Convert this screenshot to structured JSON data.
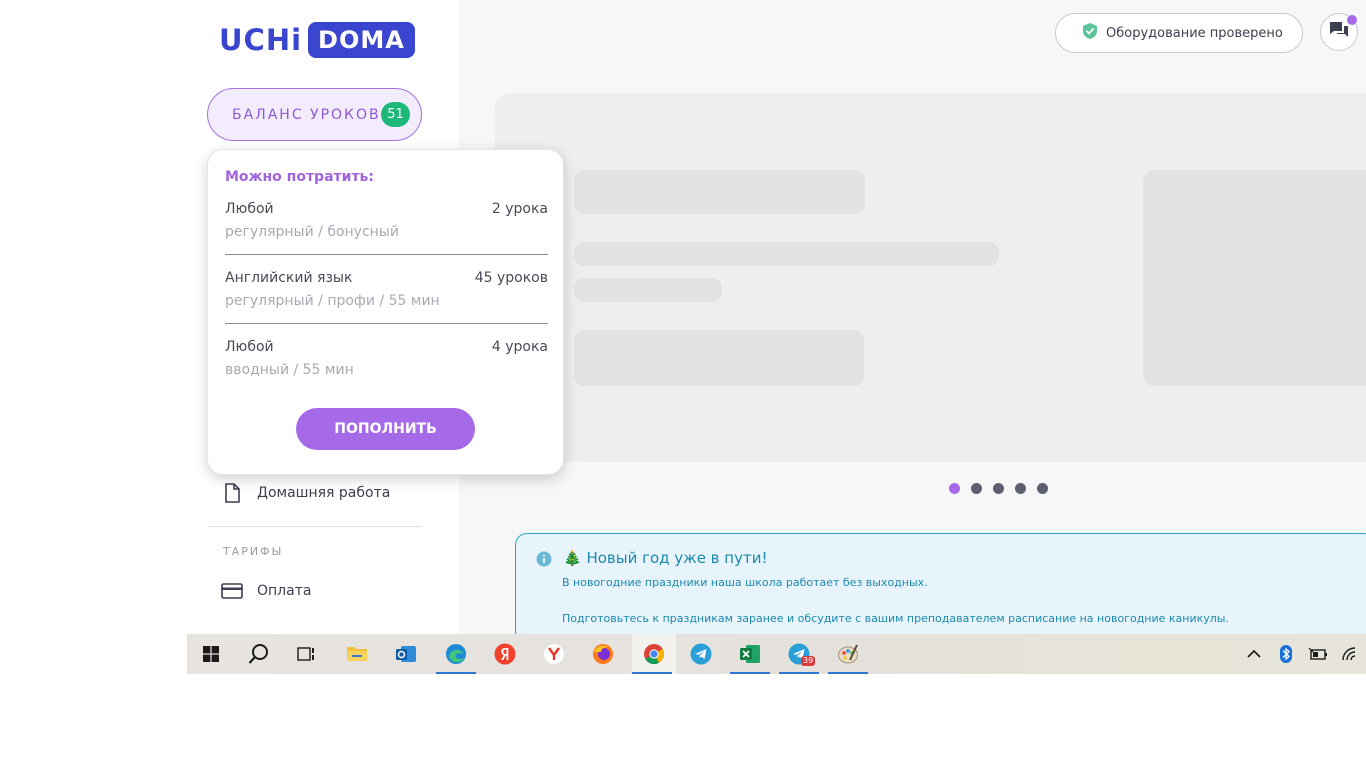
{
  "sidebar": {
    "logo_left": "UCHi",
    "logo_right": "DOMA",
    "balance_label": "БАЛАНС УРОКОВ",
    "balance_count": "51",
    "homework_label": "Домашняя работа",
    "section_tariffs": "ТАРИФЫ",
    "payment_label": "Оплата"
  },
  "popup": {
    "title": "Можно потратить:",
    "lessons": [
      {
        "subject": "Любой",
        "count": "2 урока",
        "details": "регулярный / бонусный"
      },
      {
        "subject": "Английский язык",
        "count": "45 уроков",
        "details": "регулярный / профи / 55 мин"
      },
      {
        "subject": "Любой",
        "count": "4 урока",
        "details": "вводный / 55 мин"
      }
    ],
    "refill_button": "ПОПОЛНИТЬ"
  },
  "header": {
    "equipment_status": "Оборудование проверено"
  },
  "carousel": {
    "slides": 5,
    "active_index": 0
  },
  "notice": {
    "title": "🎄 Новый год уже в пути!",
    "line1": "В новогодние праздники наша школа работает без выходных.",
    "line2": "Подготовьтесь к праздникам заранее и обсудите с вашим преподавателем расписание на новогодние каникулы."
  },
  "taskbar": {
    "telegram_badge": "39"
  },
  "colors": {
    "brand": "#3b46d0",
    "accent": "#a66ae8",
    "success": "#1eb87a",
    "info": "#1c89ad"
  }
}
